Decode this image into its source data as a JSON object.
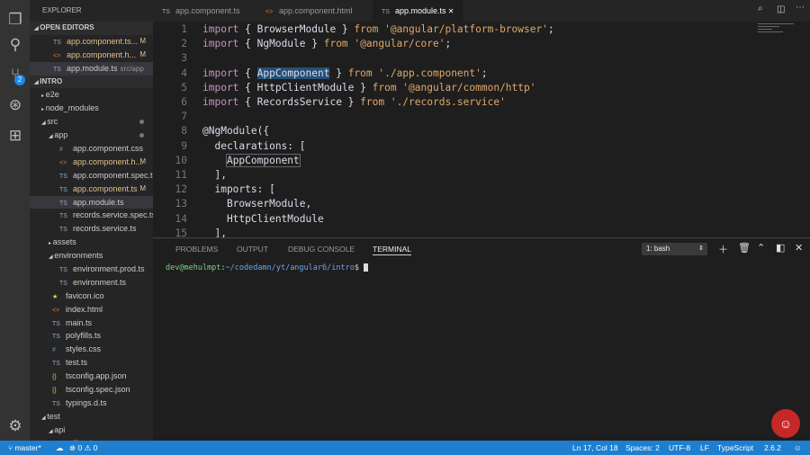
{
  "activity_bar": {
    "icons": [
      "files-icon",
      "search-icon",
      "source-control-icon",
      "debug-icon",
      "extensions-icon"
    ],
    "scm_badge": "2"
  },
  "sidebar": {
    "title": "EXPLORER",
    "open_editors_label": "OPEN EDITORS",
    "open_editors": [
      {
        "icon": "TS",
        "name": "app.component.ts...",
        "status": "M",
        "modified": true
      },
      {
        "icon": "<>",
        "name": "app.component.h...",
        "status": "M",
        "modified": true
      },
      {
        "icon": "TS",
        "name": "app.module.ts",
        "path": "src/app",
        "selected": true
      }
    ],
    "project_label": "INTRO",
    "tree": [
      {
        "depth": 1,
        "type": "folder",
        "open": false,
        "name": "e2e"
      },
      {
        "depth": 1,
        "type": "folder",
        "open": false,
        "name": "node_modules"
      },
      {
        "depth": 1,
        "type": "folder",
        "open": true,
        "name": "src",
        "dot": true
      },
      {
        "depth": 2,
        "type": "folder",
        "open": true,
        "name": "app",
        "dot": true,
        "modified": true
      },
      {
        "depth": 3,
        "icon": "#",
        "name": "app.component.css"
      },
      {
        "depth": 3,
        "icon": "<>",
        "name": "app.component.h...",
        "status": "M",
        "modified": true
      },
      {
        "depth": 3,
        "icon": "TS",
        "name": "app.component.spec.ts"
      },
      {
        "depth": 3,
        "icon": "TS",
        "name": "app.component.ts",
        "status": "M",
        "modified": true
      },
      {
        "depth": 3,
        "icon": "TS",
        "name": "app.module.ts",
        "selected": true
      },
      {
        "depth": 3,
        "icon": "TS",
        "name": "records.service.spec.ts"
      },
      {
        "depth": 3,
        "icon": "TS",
        "name": "records.service.ts"
      },
      {
        "depth": 2,
        "type": "folder",
        "open": false,
        "name": "assets"
      },
      {
        "depth": 2,
        "type": "folder",
        "open": true,
        "name": "environments"
      },
      {
        "depth": 3,
        "icon": "TS",
        "name": "environment.prod.ts"
      },
      {
        "depth": 3,
        "icon": "TS",
        "name": "environment.ts"
      },
      {
        "depth": 2,
        "icon": "★",
        "name": "favicon.ico"
      },
      {
        "depth": 2,
        "icon": "<>",
        "name": "index.html"
      },
      {
        "depth": 2,
        "icon": "TS",
        "name": "main.ts"
      },
      {
        "depth": 2,
        "icon": "TS",
        "name": "polyfills.ts"
      },
      {
        "depth": 2,
        "icon": "#",
        "name": "styles.css"
      },
      {
        "depth": 2,
        "icon": "TS",
        "name": "test.ts"
      },
      {
        "depth": 2,
        "icon": "{}",
        "name": "tsconfig.app.json"
      },
      {
        "depth": 2,
        "icon": "{}",
        "name": "tsconfig.spec.json"
      },
      {
        "depth": 2,
        "icon": "TS",
        "name": "typings.d.ts"
      },
      {
        "depth": 1,
        "type": "folder",
        "open": true,
        "name": "test"
      },
      {
        "depth": 2,
        "type": "folder",
        "open": true,
        "name": "api"
      },
      {
        "depth": 3,
        "icon": "php",
        "name": "file.php"
      }
    ]
  },
  "tabs": [
    {
      "icon": "TS",
      "label": "app.component.ts"
    },
    {
      "icon": "<>",
      "label": "app.component.html"
    },
    {
      "icon": "TS",
      "label": "app.module.ts",
      "active": true
    }
  ],
  "code": [
    [
      [
        "k",
        "import"
      ],
      [
        "p",
        " { BrowserModule } "
      ],
      [
        "f",
        "from"
      ],
      [
        "s",
        " '@angular/platform-browser'"
      ],
      [
        "p",
        ";"
      ]
    ],
    [
      [
        "k",
        "import"
      ],
      [
        "p",
        " { NgModule } "
      ],
      [
        "f",
        "from"
      ],
      [
        "s",
        " '@angular/core'"
      ],
      [
        "p",
        ";"
      ]
    ],
    [],
    [
      [
        "k",
        "import"
      ],
      [
        "p",
        " { "
      ],
      [
        "hl",
        "AppComponent"
      ],
      [
        "p",
        " } "
      ],
      [
        "f",
        "from"
      ],
      [
        "s",
        " './app.component'"
      ],
      [
        "p",
        ";"
      ]
    ],
    [
      [
        "k",
        "import"
      ],
      [
        "p",
        " { HttpClientModule } "
      ],
      [
        "f",
        "from"
      ],
      [
        "s",
        " '@angular/common/http'"
      ]
    ],
    [
      [
        "k",
        "import"
      ],
      [
        "p",
        " { RecordsService } "
      ],
      [
        "f",
        "from"
      ],
      [
        "s",
        " './records.service'"
      ]
    ],
    [],
    [
      [
        "p",
        "@NgModule({"
      ]
    ],
    [
      [
        "p",
        "  declarations: ["
      ]
    ],
    [
      [
        "p",
        "    "
      ],
      [
        "bx",
        "AppComponent"
      ]
    ],
    [
      [
        "p",
        "  ],"
      ]
    ],
    [
      [
        "p",
        "  imports: ["
      ]
    ],
    [
      [
        "p",
        "    BrowserModule,"
      ]
    ],
    [
      [
        "p",
        "    HttpClientModule"
      ]
    ],
    [
      [
        "p",
        "  ],"
      ]
    ]
  ],
  "panel": {
    "tabs": [
      "PROBLEMS",
      "OUTPUT",
      "DEBUG CONSOLE",
      "TERMINAL"
    ],
    "active": "TERMINAL",
    "terminal_select": "1: bash",
    "terminal": {
      "user": "dev@mehulmpt",
      "sep": ":",
      "path": "~/codedamn/yt/angular6/intro",
      "prompt": "$ "
    }
  },
  "status": {
    "branch": "master*",
    "errors": "0",
    "warnings": "0",
    "position": "Ln 17, Col 18",
    "spaces": "Spaces: 2",
    "encoding": "UTF-8",
    "eol": "LF",
    "language": "TypeScript",
    "version": "2.6.2"
  },
  "colors": {
    "status_bar": "#1e7fd0",
    "accent_badge": "#1e88e5",
    "modified": "#e2c08d"
  }
}
